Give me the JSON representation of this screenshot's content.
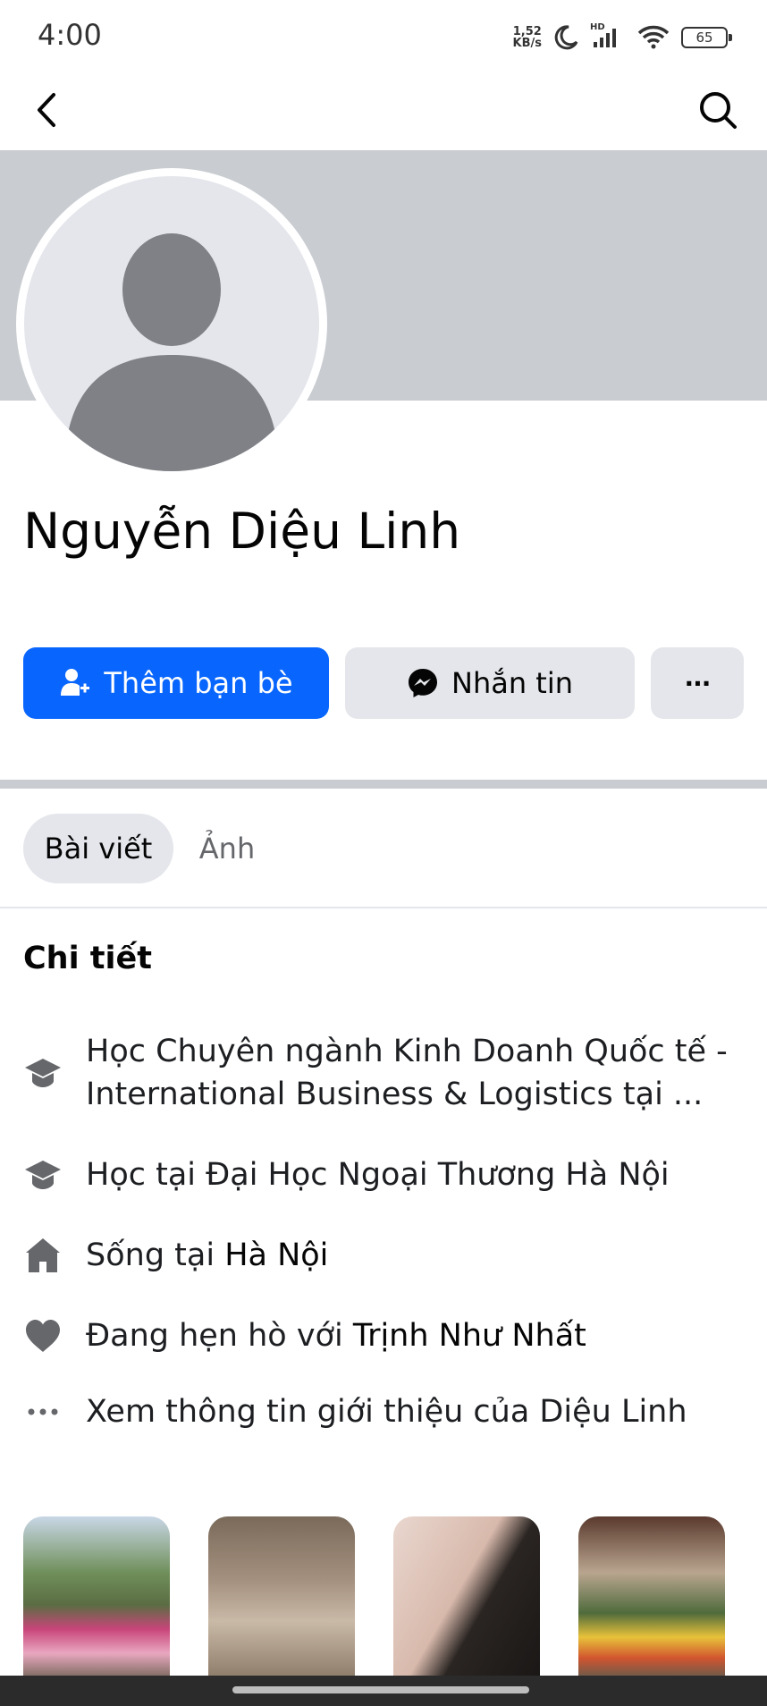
{
  "status_bar": {
    "time": "4:00",
    "net_speed_value": "1,52",
    "net_speed_unit": "KB/s",
    "hd_label": "HD",
    "battery": "65"
  },
  "top_nav": {
    "back_icon": "chevron-left-icon",
    "search_icon": "search-icon"
  },
  "profile": {
    "name": "Nguyễn Diệu Linh"
  },
  "actions": {
    "add_friend_label": "Thêm bạn bè",
    "message_label": "Nhắn tin",
    "more_label": "···"
  },
  "tabs": [
    {
      "label": "Bài viết",
      "selected": true
    },
    {
      "label": "Ảnh",
      "selected": false
    }
  ],
  "details": {
    "title": "Chi tiết",
    "items": [
      {
        "icon": "graduation-cap-icon",
        "text": "Học Chuyên ngành Kinh Doanh Quốc tế - International Business & Logistics tại ..."
      },
      {
        "icon": "graduation-cap-icon",
        "text": "Học tại Đại Học Ngoại Thương Hà Nội"
      },
      {
        "icon": "home-icon",
        "prefix": "Sống tại ",
        "strong": "Hà Nội"
      },
      {
        "icon": "heart-icon",
        "prefix": "Đang hẹn hò với ",
        "strong": "Trịnh Như Nhất"
      },
      {
        "icon": "more-dots-icon",
        "text": "Xem thông tin giới thiệu của Diệu Linh"
      }
    ]
  },
  "colors": {
    "primary": "#0866ff",
    "secondary_button": "#e4e6eb",
    "cover": "#c9ccd1",
    "icon_gray": "#65676b"
  }
}
